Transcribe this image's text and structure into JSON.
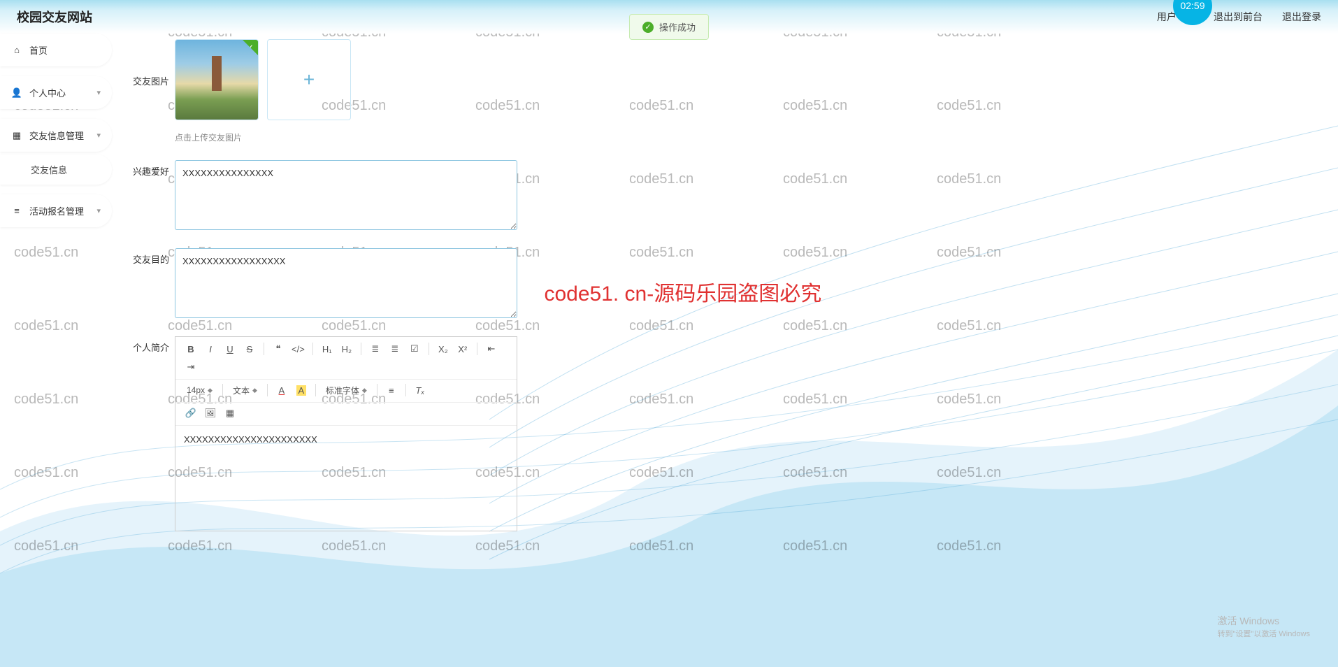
{
  "header": {
    "site_title": "校园交友网站",
    "user": "用户 111",
    "logout_front": "退出到前台",
    "logout": "退出登录",
    "time": "02:59"
  },
  "toast": {
    "text": "操作成功"
  },
  "sidebar": {
    "home": "首页",
    "profile": "个人中心",
    "friend_mgmt": "交友信息管理",
    "friend_info": "交友信息",
    "activity": "活动报名管理"
  },
  "form": {
    "img_label": "交友图片",
    "upload_hint": "点击上传交友图片",
    "hobby_label": "兴趣爱好",
    "hobby_val": "XXXXXXXXXXXXXXX",
    "goal_label": "交友目的",
    "goal_val": "XXXXXXXXXXXXXXXXX",
    "intro_label": "个人简介",
    "intro_val": "XXXXXXXXXXXXXXXXXXXXXX"
  },
  "editor": {
    "font_size": "14px",
    "text_menu": "文本",
    "color_a": "A",
    "font_family": "标准字体",
    "b": "B",
    "i": "I",
    "u": "U",
    "s": "S",
    "quote": "❝",
    "code": "</>",
    "h1": "H₁",
    "h2": "H₂",
    "ul": "≣",
    "ol": "≣",
    "cl": "☑",
    "sub": "X₂",
    "sup": "X²",
    "ind": "⇤",
    "out": "⇥",
    "align": "≡",
    "clear": "Tₓ",
    "link": "🔗",
    "img": "🖼",
    "vid": "▦"
  },
  "watermark": {
    "text": "code51.cn",
    "big": "code51. cn-源码乐园盗图必究"
  },
  "win": {
    "title": "激活 Windows",
    "sub": "转到\"设置\"以激活 Windows"
  }
}
